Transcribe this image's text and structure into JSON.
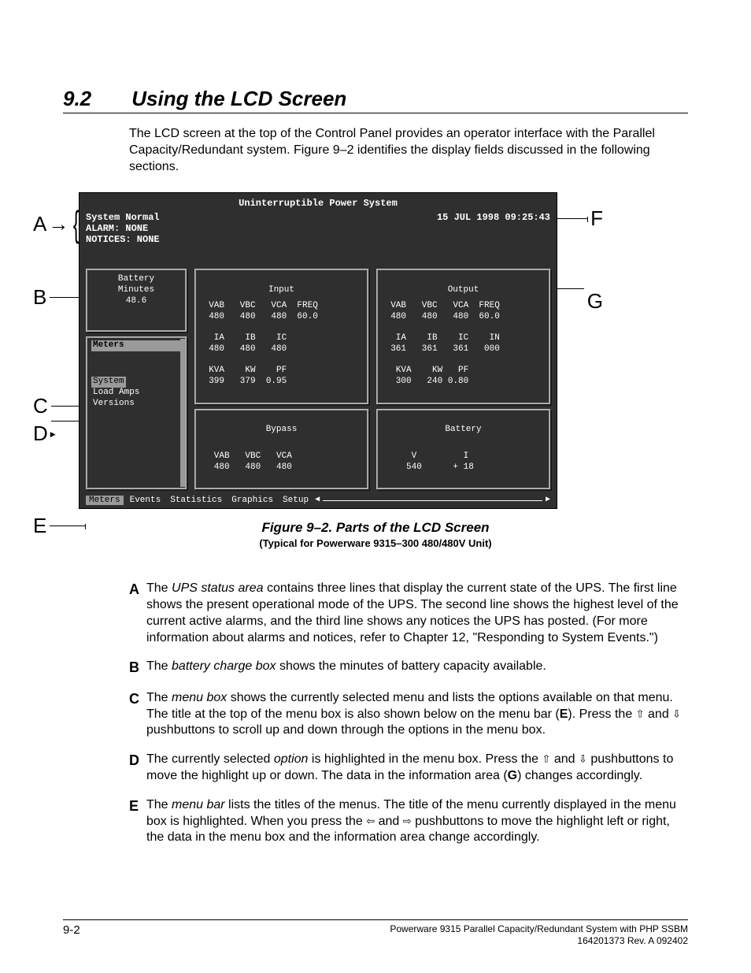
{
  "section": {
    "num": "9.2",
    "title": "Using the LCD Screen"
  },
  "intro": "The LCD screen at the top of the Control Panel provides an operator interface with the Parallel Capacity/Redundant system.  Figure 9–2 identifies the display fields discussed in the following sections.",
  "lcd": {
    "title": "Uninterruptible Power System",
    "status": {
      "l1": "System Normal",
      "l2": "ALARM:  NONE",
      "l3": "NOTICES: NONE"
    },
    "datetime": "15 JUL 1998  09:25:43",
    "battery": {
      "label": "Battery\nMinutes",
      "value": "48.6"
    },
    "menu": {
      "title": "Meters",
      "selected": "System",
      "items": [
        "Load Amps",
        "Versions"
      ]
    },
    "panels": {
      "input": {
        "title": "Input",
        "r1": "  VAB   VBC   VCA  FREQ",
        "r2": "  480   480   480  60.0",
        "r3": "   IA    IB    IC",
        "r4": "  480   480   480",
        "r5": "  KVA    KW    PF",
        "r6": "  399   379  0.95"
      },
      "output": {
        "title": "Output",
        "r1": "  VAB   VBC   VCA  FREQ",
        "r2": "  480   480   480  60.0",
        "r3": "   IA    IB    IC    IN",
        "r4": "  361   361   361   000",
        "r5": "   KVA    KW   PF",
        "r6": "   300   240 0.80"
      },
      "bypass": {
        "title": "Bypass",
        "r1": "   VAB   VBC   VCA",
        "r2": "   480   480   480"
      },
      "battery_p": {
        "title": "Battery",
        "r1": "      V         I",
        "r2": "     540      + 18"
      }
    },
    "menubar": [
      "Meters",
      "Events",
      "Statistics",
      "Graphics",
      "Setup"
    ]
  },
  "callouts": {
    "A": "A",
    "B": "B",
    "C": "C",
    "D": "D",
    "E": "E",
    "F": "F",
    "G": "G"
  },
  "figcaption": {
    "line1": "Figure 9–2.   Parts of the LCD Screen",
    "line2": "(Typical for Powerware 9315–300 480/480V Unit)"
  },
  "desc": {
    "A": {
      "pre": "The ",
      "it": "UPS status area",
      "post": " contains three lines that display the current state of the UPS.  The first line shows the present operational mode of the UPS.  The second line shows the highest level of the current active alarms, and the third line shows any notices the UPS has posted.  (For more information about alarms and notices, refer to Chapter 12, \"Responding to System Events.\")"
    },
    "B": {
      "pre": "The ",
      "it": "battery charge box",
      "post": " shows the minutes of battery capacity available."
    },
    "C": {
      "pre": "The ",
      "it": "menu box",
      "post_a": " shows the currently selected menu and lists the options available on that menu. The title at the top of the menu box is also shown below on the menu bar (",
      "ref": "E",
      "post_b": ").  Press the ",
      "g1": "⇧",
      "mid": " and ",
      "g2": "⇩",
      "post_c": " pushbuttons to scroll up and down through the options in the menu box."
    },
    "D": {
      "pre": "The currently selected ",
      "it": "option",
      "post_a": " is highlighted in the menu box.  Press the ",
      "g1": "⇧",
      "mid": " and ",
      "g2": "⇩",
      "post_b": " pushbuttons to move the highlight up or down. The data in the information area (",
      "ref": "G",
      "post_c": ") changes accordingly."
    },
    "E": {
      "pre": "The ",
      "it": "menu bar",
      "post_a": " lists the titles of the menus.  The title of the menu currently displayed in the menu box is highlighted.  When you press the ",
      "g1": "⇦",
      "mid": " and ",
      "g2": "⇨",
      "post_b": " pushbuttons to move the highlight left or right, the data in the menu box and the information area change accordingly."
    }
  },
  "footer": {
    "page": "9-2",
    "r1": "Powerware 9315 Parallel Capacity/Redundant System with PHP SSBM",
    "r2": "164201373   Rev. A    092402"
  }
}
